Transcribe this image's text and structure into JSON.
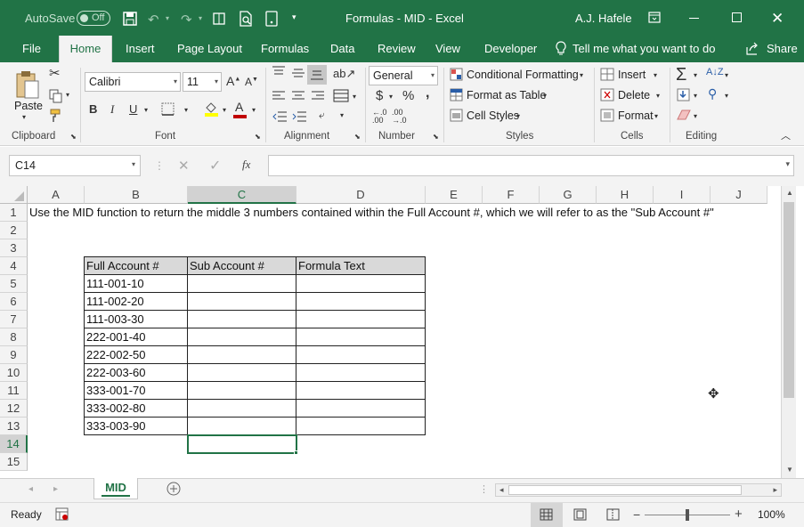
{
  "titlebar": {
    "autosave_label": "AutoSave",
    "autosave_state": "Off",
    "window_title": "Formulas - MID  -  Excel",
    "user_name": "A.J. Hafele"
  },
  "ribbon_tabs": [
    "File",
    "Home",
    "Insert",
    "Page Layout",
    "Formulas",
    "Data",
    "Review",
    "View",
    "Developer"
  ],
  "tell_me": "Tell me what you want to do",
  "share_label": "Share",
  "ribbon": {
    "clipboard": {
      "paste": "Paste",
      "label": "Clipboard"
    },
    "font": {
      "name": "Calibri",
      "size": "11",
      "label": "Font",
      "bold": "B",
      "italic": "I",
      "underline": "U"
    },
    "alignment": {
      "label": "Alignment"
    },
    "number": {
      "format": "General",
      "label": "Number",
      "currency": "$",
      "percent": "%",
      "comma": ","
    },
    "styles": {
      "conditional": "Conditional Formatting",
      "format_table": "Format as Table",
      "cell_styles": "Cell Styles",
      "label": "Styles"
    },
    "cells": {
      "insert": "Insert",
      "delete": "Delete",
      "format": "Format",
      "label": "Cells"
    },
    "editing": {
      "label": "Editing"
    }
  },
  "formula_bar": {
    "name_box": "C14",
    "formula": ""
  },
  "columns": [
    "A",
    "B",
    "C",
    "D",
    "E",
    "F",
    "G",
    "H",
    "I",
    "J"
  ],
  "rows": [
    "1",
    "2",
    "3",
    "4",
    "5",
    "6",
    "7",
    "8",
    "9",
    "10",
    "11",
    "12",
    "13",
    "14",
    "15"
  ],
  "selected_cell": "C14",
  "instruction": "Use the MID function to return the middle 3 numbers contained within the Full Account #, which we will refer to as the \"Sub Account #\"",
  "table": {
    "headers": [
      "Full Account #",
      "Sub Account #",
      "Formula Text"
    ],
    "full_accounts": [
      "111-001-10",
      "111-002-20",
      "111-003-30",
      "222-001-40",
      "222-002-50",
      "222-003-60",
      "333-001-70",
      "333-002-80",
      "333-003-90"
    ]
  },
  "sheet_tab": "MID",
  "status": {
    "ready": "Ready",
    "zoom": "100%"
  },
  "colors": {
    "brand": "#217346",
    "header_fill": "#d9d9d9",
    "selection": "#217346"
  }
}
